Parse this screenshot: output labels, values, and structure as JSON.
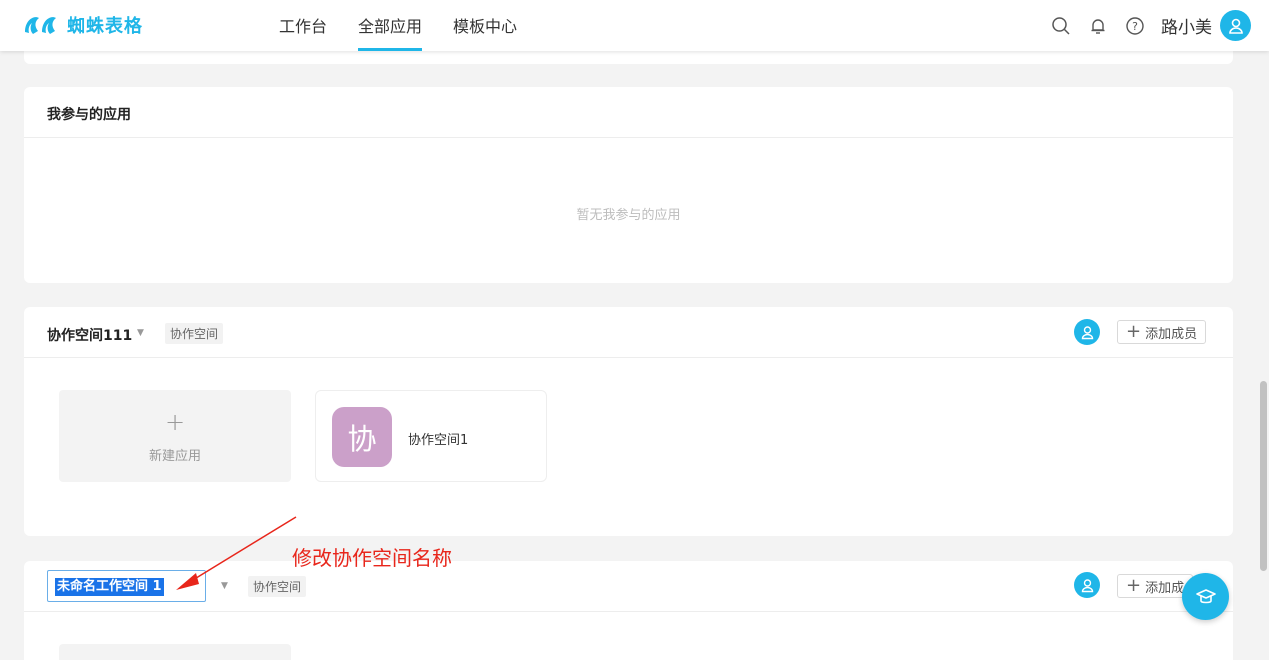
{
  "brand": {
    "name": "蜘蛛表格",
    "accent": "#1fb6e8"
  },
  "nav": {
    "items": [
      {
        "label": "工作台",
        "active": false
      },
      {
        "label": "全部应用",
        "active": true
      },
      {
        "label": "模板中心",
        "active": false
      }
    ]
  },
  "header": {
    "icons": [
      "search-icon",
      "bell-icon",
      "help-icon"
    ],
    "username": "路小美"
  },
  "participated": {
    "title": "我参与的应用",
    "empty_text": "暂无我参与的应用"
  },
  "workspace1": {
    "name": "协作空间111",
    "tag": "协作空间",
    "add_member_label": "添加成员",
    "new_app_label": "新建应用",
    "apps": [
      {
        "icon_char": "协",
        "name": "协作空间1",
        "color": "#cba0c9"
      }
    ]
  },
  "workspace2": {
    "name_input_value": "未命名工作空间 1",
    "tag": "协作空间",
    "add_member_label": "添加成"
  },
  "annotation": {
    "text": "修改协作空间名称",
    "color": "#e8261b"
  }
}
